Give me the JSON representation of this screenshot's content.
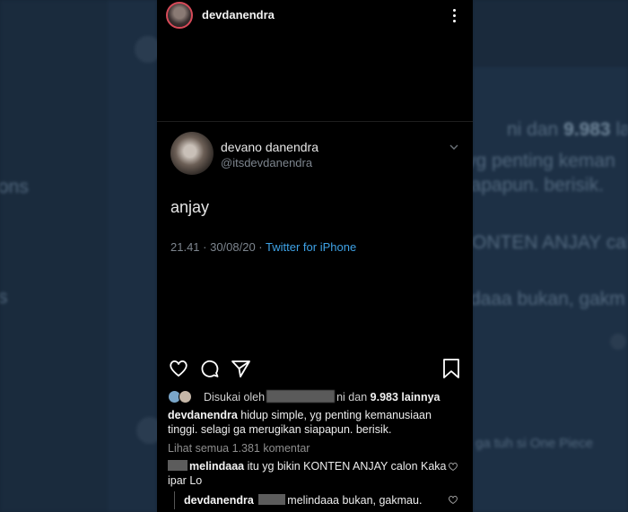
{
  "background": {
    "snippets": [
      "ons",
      "s",
      "ni dan",
      "9.983",
      "la",
      "yg penting keman",
      "iapapun. berisik.",
      "KONTEN ANJAY calo",
      "daaa bukan, gakm",
      "ga tuh si One Piece"
    ]
  },
  "header": {
    "username": "devdanendra",
    "more_icon": "more-vertical-icon"
  },
  "tweet": {
    "display_name": "devano danendra",
    "handle": "@itsdevdanendra",
    "text": "anjay",
    "timestamp": "21.41 · 30/08/20 · ",
    "source": "Twitter for iPhone",
    "source_color": "#3ea2e6"
  },
  "actions": {
    "like": "heart-icon",
    "comment": "comment-icon",
    "share": "send-icon",
    "save": "bookmark-icon"
  },
  "likes": {
    "prefix": "Disukai oleh",
    "mid": "ni dan",
    "count": "9.983",
    "suffix": "lainnya"
  },
  "caption": {
    "username": "devdanendra",
    "text": "hidup simple, yg penting kemanusiaan tinggi. selagi ga merugikan siapapun. berisik."
  },
  "view_all_comments": "Lihat semua 1.381 komentar",
  "comments": [
    {
      "username": "melindaaa",
      "text": "itu yg bikin KONTEN ANJAY calon Kaka ipar Lo"
    },
    {
      "username": "devdanendra",
      "mention": "melindaaa",
      "text": "bukan, gakmau."
    }
  ]
}
